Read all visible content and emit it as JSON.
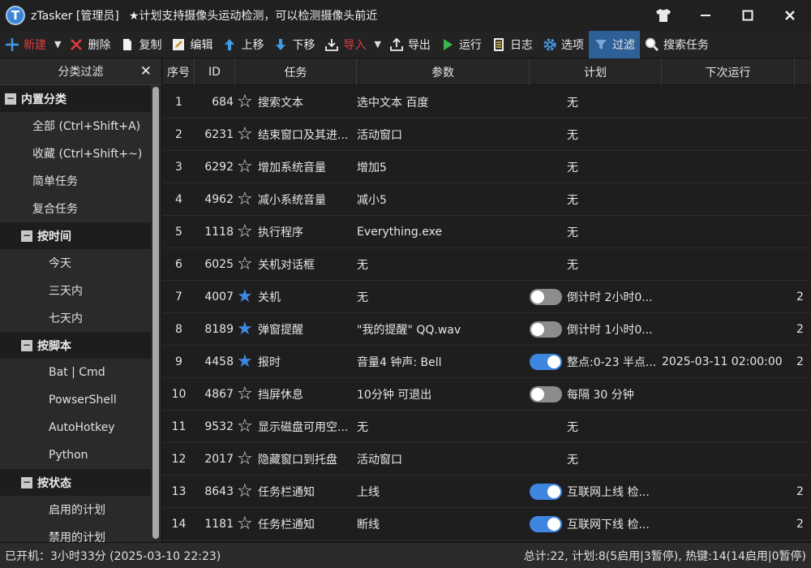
{
  "app": {
    "logo_letter": "T",
    "title": "zTasker [管理员]",
    "notice": "★计划支持摄像头运动检测，可以检测摄像头前近"
  },
  "toolbar": {
    "new": "新建",
    "delete": "删除",
    "copy": "复制",
    "edit": "编辑",
    "move_up": "上移",
    "move_down": "下移",
    "import": "导入",
    "export": "导出",
    "run": "运行",
    "log": "日志",
    "options": "选项",
    "filter": "过滤",
    "search": "搜索任务"
  },
  "sidebar": {
    "header": "分类过滤",
    "groups": [
      {
        "label": "内置分类",
        "items": [
          "全部 (Ctrl+Shift+A)",
          "收藏 (Ctrl+Shift+~)",
          "简单任务",
          "复合任务"
        ]
      },
      {
        "label": "按时间",
        "items": [
          "今天",
          "三天内",
          "七天内"
        ]
      },
      {
        "label": "按脚本",
        "items": [
          "Bat | Cmd",
          "PowserShell",
          "AutoHotkey",
          "Python"
        ]
      },
      {
        "label": "按状态",
        "items": [
          "启用的计划",
          "禁用的计划"
        ]
      }
    ]
  },
  "table": {
    "columns": [
      "序号",
      "ID",
      "任务",
      "参数",
      "计划",
      "下次运行"
    ],
    "rows": [
      {
        "seq": "1",
        "id": "684",
        "fav": false,
        "task": "搜索文本",
        "param": "选中文本 百度",
        "toggle": "none",
        "plan": "无",
        "next": "",
        "extra": ""
      },
      {
        "seq": "2",
        "id": "6231",
        "fav": false,
        "task": "结束窗口及其进...",
        "param": "活动窗口",
        "toggle": "none",
        "plan": "无",
        "next": "",
        "extra": ""
      },
      {
        "seq": "3",
        "id": "6292",
        "fav": false,
        "task": "增加系统音量",
        "param": "增加5",
        "toggle": "none",
        "plan": "无",
        "next": "",
        "extra": ""
      },
      {
        "seq": "4",
        "id": "4962",
        "fav": false,
        "task": "减小系统音量",
        "param": "减小5",
        "toggle": "none",
        "plan": "无",
        "next": "",
        "extra": ""
      },
      {
        "seq": "5",
        "id": "1118",
        "fav": false,
        "task": "执行程序",
        "param": "Everything.exe",
        "toggle": "none",
        "plan": "无",
        "next": "",
        "extra": ""
      },
      {
        "seq": "6",
        "id": "6025",
        "fav": false,
        "task": "关机对话框",
        "param": "无",
        "toggle": "none",
        "plan": "无",
        "next": "",
        "extra": ""
      },
      {
        "seq": "7",
        "id": "4007",
        "fav": true,
        "task": "关机",
        "param": "无",
        "toggle": "off",
        "plan": "倒计时 2小时0...",
        "next": "",
        "extra": "2"
      },
      {
        "seq": "8",
        "id": "8189",
        "fav": true,
        "task": "弹窗提醒",
        "param": "\"我的提醒\" QQ.wav",
        "toggle": "off",
        "plan": "倒计时 1小时0...",
        "next": "",
        "extra": "2"
      },
      {
        "seq": "9",
        "id": "4458",
        "fav": true,
        "task": "报时",
        "param": "音量4 钟声: Bell",
        "toggle": "on",
        "plan": "整点:0-23 半点...",
        "next": "2025-03-11 02:00:00",
        "extra": "2"
      },
      {
        "seq": "10",
        "id": "4867",
        "fav": false,
        "task": "挡屏休息",
        "param": "10分钟 可退出",
        "toggle": "off",
        "plan": "每隔 30 分钟",
        "next": "",
        "extra": ""
      },
      {
        "seq": "11",
        "id": "9532",
        "fav": false,
        "task": "显示磁盘可用空...",
        "param": "无",
        "toggle": "none",
        "plan": "无",
        "next": "",
        "extra": ""
      },
      {
        "seq": "12",
        "id": "2017",
        "fav": false,
        "task": "隐藏窗口到托盘",
        "param": "活动窗口",
        "toggle": "none",
        "plan": "无",
        "next": "",
        "extra": ""
      },
      {
        "seq": "13",
        "id": "8643",
        "fav": false,
        "task": "任务栏通知",
        "param": "上线",
        "toggle": "on",
        "plan": "互联网上线 检...",
        "next": "",
        "extra": "2"
      },
      {
        "seq": "14",
        "id": "1181",
        "fav": false,
        "task": "任务栏通知",
        "param": "断线",
        "toggle": "on",
        "plan": "互联网下线 检...",
        "next": "",
        "extra": "2"
      }
    ]
  },
  "status": {
    "left": "已开机：3小时33分 (2025-03-10 22:23)",
    "right": "总计:22, 计划:8(5启用|3暂停), 热键:14(14启用|0暂停)"
  }
}
